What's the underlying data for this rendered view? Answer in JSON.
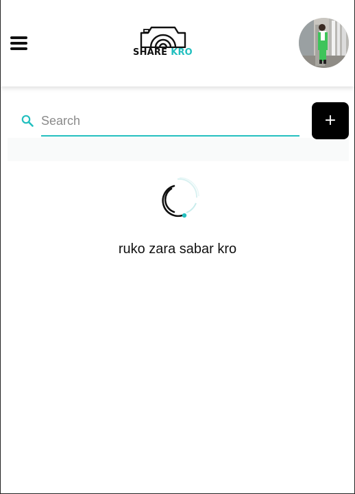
{
  "app": {
    "logo": {
      "word1": "SHARE",
      "word2": "KRO"
    }
  },
  "header": {
    "menu_icon": "hamburger-icon",
    "avatar_icon": "user-avatar"
  },
  "search": {
    "placeholder": "Search",
    "value": "",
    "icon": "search-icon"
  },
  "actions": {
    "add_label": "+"
  },
  "loader": {
    "text": "ruko zara sabar kro"
  },
  "colors": {
    "accent": "#22bfbf",
    "button_bg": "#000000",
    "text": "#111111"
  }
}
